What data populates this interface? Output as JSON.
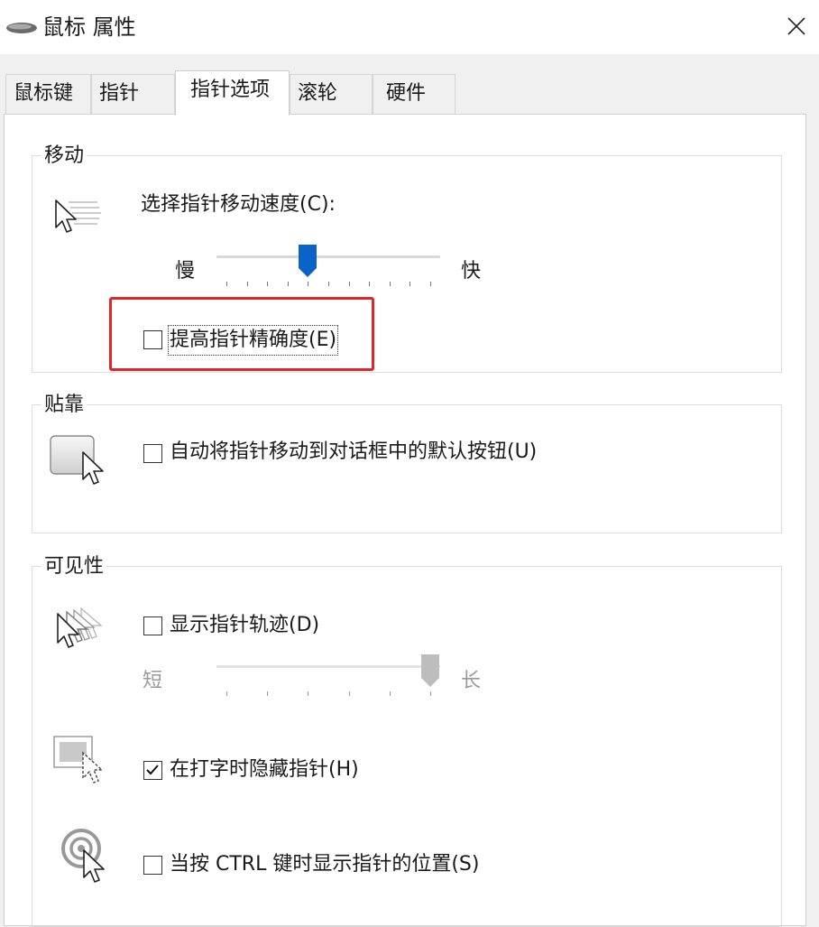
{
  "window": {
    "title": "鼠标 属性",
    "close_icon": "close-icon"
  },
  "tabs": [
    {
      "label": "鼠标键",
      "active": false
    },
    {
      "label": "指针",
      "active": false
    },
    {
      "label": "指针选项",
      "active": true
    },
    {
      "label": "滚轮",
      "active": false
    },
    {
      "label": "硬件",
      "active": false
    }
  ],
  "motion": {
    "group_title": "移动",
    "speed_label": "选择指针移动速度(C):",
    "slow_label": "慢",
    "fast_label": "快",
    "speed_value_fraction": 0.4,
    "precision_checkbox": {
      "label": "提高指针精确度(E)",
      "checked": false
    }
  },
  "snap_to": {
    "group_title": "贴靠",
    "checkbox": {
      "label": "自动将指针移动到对话框中的默认按钮(U)",
      "checked": false
    }
  },
  "visibility": {
    "group_title": "可见性",
    "trails_checkbox": {
      "label": "显示指针轨迹(D)",
      "checked": false
    },
    "short_label": "短",
    "long_label": "长",
    "trail_value_fraction": 1.0,
    "hide_typing_checkbox": {
      "label": "在打字时隐藏指针(H)",
      "checked": true
    },
    "ctrl_checkbox": {
      "label": "当按 CTRL 键时显示指针的位置(S)",
      "checked": false
    }
  },
  "colors": {
    "slider_thumb": "#0a64c8",
    "slider_disabled": "#bdbdbd",
    "highlight_box": "#e0252b"
  }
}
